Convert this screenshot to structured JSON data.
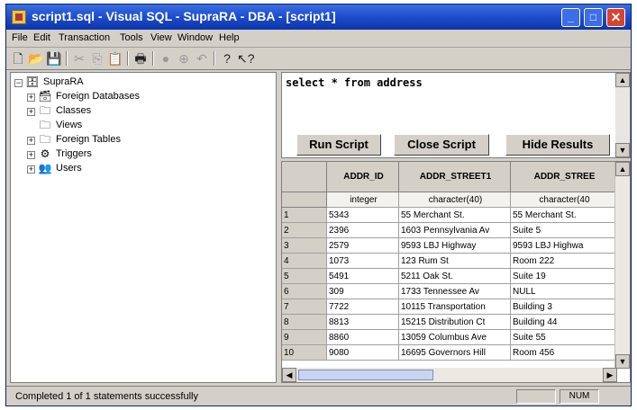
{
  "window": {
    "title": "script1.sql - Visual SQL - SupraRA - DBA - [script1]"
  },
  "menu": [
    "File",
    "Edit",
    "Transaction",
    "Tools",
    "View",
    "Window",
    "Help"
  ],
  "toolbar": [
    "new-file-icon",
    "open-folder-icon",
    "save-icon",
    "cut-icon",
    "copy-icon",
    "paste-icon",
    "print-icon",
    "run-icon",
    "stop-icon",
    "undo-icon",
    "help-icon",
    "context-help-icon"
  ],
  "tree": {
    "root": "SupraRA",
    "items": [
      "Foreign Databases",
      "Classes",
      "Views",
      "Foreign Tables",
      "Triggers",
      "Users"
    ]
  },
  "sql": {
    "text": "select * from address"
  },
  "buttons": {
    "run": "Run Script",
    "close": "Close Script",
    "hide": "Hide Results"
  },
  "grid": {
    "headers": [
      "ADDR_ID",
      "ADDR_STREET1",
      "ADDR_STREE"
    ],
    "types": [
      "integer",
      "character(40)",
      "character(40"
    ],
    "rows": [
      [
        "1",
        "5343",
        "55 Merchant St.",
        "55 Merchant St."
      ],
      [
        "2",
        "2396",
        "1603 Pennsylvania Av",
        "Suite 5"
      ],
      [
        "3",
        "2579",
        "9593 LBJ Highway",
        "9593 LBJ Highwa"
      ],
      [
        "4",
        "1073",
        "123 Rum St",
        "Room 222"
      ],
      [
        "5",
        "5491",
        "5211 Oak St.",
        "Suite 19"
      ],
      [
        "6",
        "309",
        "1733 Tennessee Av",
        "NULL"
      ],
      [
        "7",
        "7722",
        "10115 Transportation",
        "Building 3"
      ],
      [
        "8",
        "8813",
        "15215 Distribution Ct",
        "Building 44"
      ],
      [
        "9",
        "8860",
        "13059 Columbus Ave",
        "Suite 55"
      ],
      [
        "10",
        "9080",
        "16695 Governors Hill",
        "Room 456"
      ]
    ]
  },
  "status": {
    "text": "Completed 1 of 1 statements successfully",
    "num": "NUM"
  }
}
